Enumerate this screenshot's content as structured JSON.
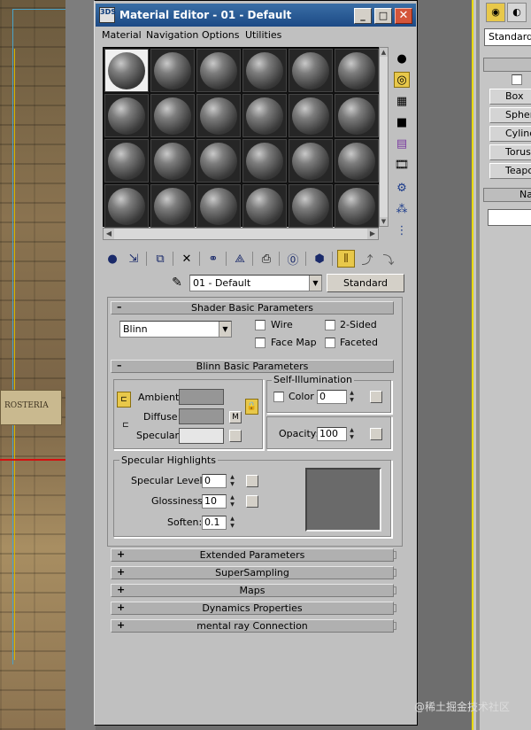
{
  "window": {
    "title": "Material Editor - 01 - Default",
    "icon_text": "3DS"
  },
  "title_buttons": {
    "minimize": "_",
    "maximize": "□",
    "close": "✕"
  },
  "menu": [
    "Material",
    "Navigation",
    "Options",
    "Utilities"
  ],
  "sample_slots": {
    "rows": 4,
    "columns": 6,
    "active_index": 0
  },
  "side_toolbar_icons": [
    "sample-type-sphere-icon",
    "backlight-icon",
    "background-checker-icon",
    "sample-uv-tiling-icon",
    "video-color-check-icon",
    "make-preview-icon",
    "options-icon",
    "select-by-material-icon",
    "material-navigator-icon"
  ],
  "toolbar_icons": [
    "get-material-icon",
    "put-to-scene-icon",
    "assign-material-icon",
    "delete-icon",
    "make-copy-icon",
    "make-unique-icon",
    "put-to-library-icon",
    "material-id-channel-icon",
    "show-map-icon",
    "show-end-result-icon",
    "go-to-parent-icon",
    "go-forward-sibling-icon"
  ],
  "material": {
    "name": "01 - Default",
    "type": "Standard"
  },
  "shader_basic": {
    "header": "Shader Basic Parameters",
    "shader": "Blinn",
    "wire_label": "Wire",
    "two_sided_label": "2-Sided",
    "face_map_label": "Face Map",
    "faceted_label": "Faceted"
  },
  "blinn_basic": {
    "header": "Blinn Basic Parameters",
    "ambient_label": "Ambient:",
    "diffuse_label": "Diffuse:",
    "specular_label": "Specular:",
    "m_label": "M",
    "ambient_color": "#969696",
    "diffuse_color": "#969696",
    "specular_color": "#e6e6e6",
    "self_illum": {
      "title": "Self-Illumination",
      "color_label": "Color",
      "value": "0"
    },
    "opacity_label": "Opacity:",
    "opacity_value": "100"
  },
  "specular_highlights": {
    "title": "Specular Highlights",
    "level_label": "Specular Level:",
    "level_value": "0",
    "glossiness_label": "Glossiness:",
    "glossiness_value": "10",
    "soften_label": "Soften:",
    "soften_value": "0.1",
    "curve_fill": "#6a6a6a"
  },
  "collapsed_rollouts": [
    {
      "sign": "+",
      "label": "Extended Parameters"
    },
    {
      "sign": "+",
      "label": "SuperSampling"
    },
    {
      "sign": "+",
      "label": "Maps"
    },
    {
      "sign": "+",
      "label": "Dynamics Properties"
    },
    {
      "sign": "+",
      "label": "mental ray Connection"
    }
  ],
  "command_panel": {
    "dropdown": "Standard P",
    "buttons": [
      "Box",
      "Sphere",
      "Cylinder",
      "Torus",
      "Teapot"
    ],
    "rollout_label": "Na"
  },
  "viewport": {
    "sign_text": "ROSTERIA"
  },
  "watermark": "@稀土掘金技术社区",
  "colors": {
    "title_bar": "#1c4a86",
    "dialog_bg": "#c0c0c0",
    "active_tool": "#e8c84a",
    "panel_border": "#e8d800"
  }
}
